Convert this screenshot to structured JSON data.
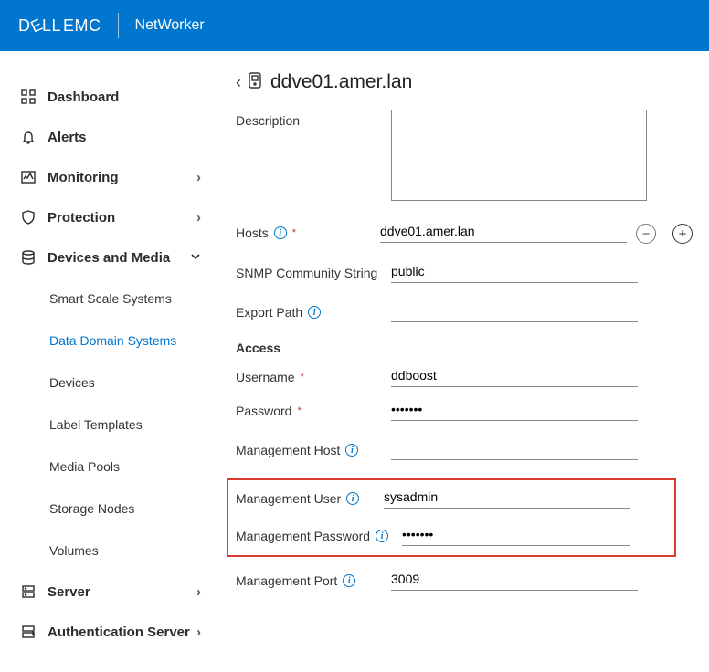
{
  "brand": {
    "part1": "D",
    "part2": "LL",
    "part3": "EMC",
    "product": "NetWorker"
  },
  "sidebar": {
    "items": [
      {
        "label": "Dashboard",
        "icon": "dashboard"
      },
      {
        "label": "Alerts",
        "icon": "bell"
      },
      {
        "label": "Monitoring",
        "icon": "monitor",
        "chev": "›"
      },
      {
        "label": "Protection",
        "icon": "shield",
        "chev": "›"
      },
      {
        "label": "Devices and Media",
        "icon": "storage",
        "expanded": true
      },
      {
        "label": "Server",
        "icon": "server",
        "chev": "›"
      },
      {
        "label": "Authentication Server",
        "icon": "auth",
        "chev": "›"
      }
    ],
    "sub": [
      "Smart Scale Systems",
      "Data Domain Systems",
      "Devices",
      "Label Templates",
      "Media Pools",
      "Storage Nodes",
      "Volumes"
    ]
  },
  "page": {
    "title": "ddve01.amer.lan"
  },
  "form": {
    "description_label": "Description",
    "description_value": "",
    "hosts_label": "Hosts",
    "hosts_value": "ddve01.amer.lan",
    "snmp_label": "SNMP Community String",
    "snmp_value": "public",
    "export_label": "Export Path",
    "export_value": "",
    "access_section": "Access",
    "username_label": "Username",
    "username_value": "ddboost",
    "password_label": "Password",
    "password_value": "•••••••",
    "mgmt_host_label": "Management Host",
    "mgmt_host_value": "",
    "mgmt_user_label": "Management User",
    "mgmt_user_value": "sysadmin",
    "mgmt_pw_label": "Management Password",
    "mgmt_pw_value": "•••••••",
    "mgmt_port_label": "Management Port",
    "mgmt_port_value": "3009"
  }
}
